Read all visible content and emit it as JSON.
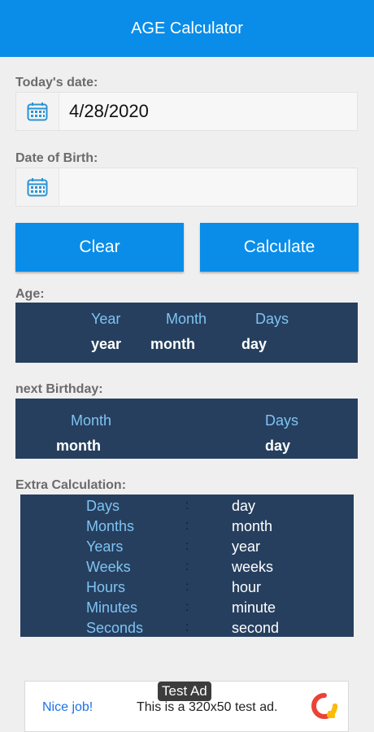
{
  "appbar": {
    "title": "AGE Calculator"
  },
  "today": {
    "label": "Today's date:",
    "value": "4/28/2020",
    "icon": "calendar-icon"
  },
  "dob": {
    "label": "Date of Birth:",
    "value": "",
    "icon": "calendar-icon"
  },
  "buttons": {
    "clear": "Clear",
    "calculate": "Calculate"
  },
  "age": {
    "label": "Age:",
    "headers": [
      "Year",
      "Month",
      "Days"
    ],
    "values": [
      "year",
      "month",
      "day"
    ]
  },
  "next_birthday": {
    "label": "next Birthday:",
    "headers": [
      "Month",
      "Days"
    ],
    "values": [
      "month",
      "day"
    ]
  },
  "extra": {
    "label": "Extra Calculation:",
    "separator": ":",
    "rows": [
      {
        "key": "Days",
        "value": "day"
      },
      {
        "key": "Months",
        "value": "month"
      },
      {
        "key": "Years",
        "value": "year"
      },
      {
        "key": "Weeks",
        "value": "weeks"
      },
      {
        "key": "Hours",
        "value": "hour"
      },
      {
        "key": "Minutes",
        "value": "minute"
      },
      {
        "key": "Seconds",
        "value": "second"
      }
    ]
  },
  "ad": {
    "tag": "Test Ad",
    "cta": "Nice job!",
    "text": "This is a 320x50 test ad.",
    "icon": "ad-choices-logo"
  },
  "colors": {
    "primary": "#0a8de8",
    "panel": "#263f5e",
    "panel_header": "#7fc3f3",
    "background": "#efefef"
  }
}
